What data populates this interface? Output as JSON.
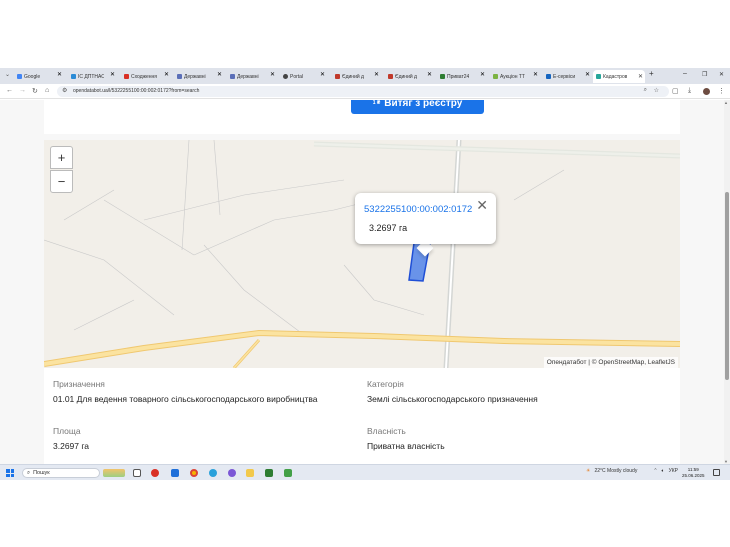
{
  "browser": {
    "tabs": [
      {
        "label": "Google",
        "color": "#4285f4"
      },
      {
        "label": "IC ДПТНАС",
        "color": "#2a8bd6"
      },
      {
        "label": "Сходження",
        "color": "#d93025"
      },
      {
        "label": "Державні",
        "color": "#5b6fb8"
      },
      {
        "label": "Державні",
        "color": "#5b6fb8"
      },
      {
        "label": "Portal",
        "color": "#444444"
      },
      {
        "label": "Єдиний д",
        "color": "#c0392b"
      },
      {
        "label": "Єдиний д",
        "color": "#c0392b"
      },
      {
        "label": "Приват24",
        "color": "#2e7d32"
      },
      {
        "label": "Аукціон ТТ",
        "color": "#7cb342"
      },
      {
        "label": "Е-сервіси",
        "color": "#1565c0"
      },
      {
        "label": "Кадастров",
        "color": "#26a69a"
      }
    ],
    "new_tab": "+",
    "url": "opendatabot.ua/l/5322255100:00:002:0172?from=search"
  },
  "page": {
    "extract_button": {
      "sup": "1 ₴",
      "label": "Витяг з реєстру"
    },
    "map": {
      "zoom_in": "+",
      "zoom_out": "−",
      "popup": {
        "cadastral": "5322255100:00:002:0172",
        "area": "3.2697 га",
        "close": "✕"
      },
      "attribution": "Опендатабот | © OpenStreetMap, LeafletJS"
    },
    "info": {
      "purpose_label": "Призначення",
      "purpose_value": "01.01 Для ведення товарного сільськогосподарського виробництва",
      "category_label": "Категорія",
      "category_value": "Землі сільськогосподарського призначення",
      "area_label": "Площа",
      "area_value": "3.2697 га",
      "ownership_label": "Власність",
      "ownership_value": "Приватна власність"
    }
  },
  "taskbar": {
    "search": "Пошук",
    "weather": "22°C  Mostly cloudy",
    "lang": "УКР",
    "time": "11:59",
    "date": "25.06.2025"
  }
}
